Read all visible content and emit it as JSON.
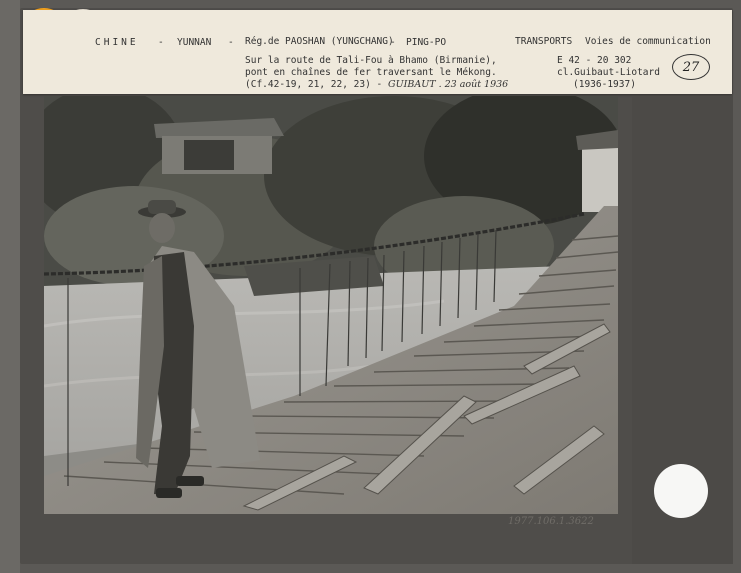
{
  "label": {
    "country": "CHINE",
    "sep1": "-",
    "province": "YUNNAN",
    "sep2": "-",
    "region": "Rég.de PAOSHAN (YUNGCHANG)",
    "sep3": "-",
    "place": "PING-PO",
    "category": "TRANSPORTS",
    "subcategory": "Voies de communication",
    "caption_line1": "Sur la route de Tali-Fou à Bhamo (Birmanie),",
    "caption_line2": "pont en chaînes de fer traversant le Mékong.",
    "caption_line3": "(Cf.42-19, 21, 22, 23) -",
    "handwritten_note": "GUIBAUT . 23 août 1936",
    "ref_code": "E  42 - 20   302",
    "collection": "cl.Guibaut-Liotard",
    "years": "(1936-1937)",
    "number": "27"
  },
  "photo": {
    "subject": "suspension chain bridge over the Mekong with a man in a long coat"
  },
  "mount": {
    "pencil_inventory": "1977.106.1.3622"
  },
  "colors": {
    "sticker": "#f3a21d",
    "label_paper": "#efe9dc",
    "mount": "#4f4d4a"
  }
}
